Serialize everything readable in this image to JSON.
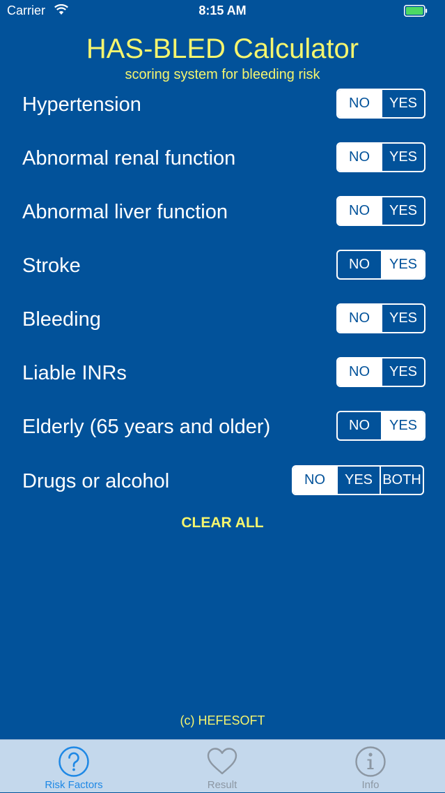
{
  "status_bar": {
    "carrier": "Carrier",
    "time": "8:15 AM"
  },
  "header": {
    "title": "HAS-BLED Calculator",
    "subtitle": "scoring system for bleeding risk"
  },
  "risk_factors": [
    {
      "label": "Hypertension",
      "options": [
        "NO",
        "YES"
      ],
      "selected": "NO"
    },
    {
      "label": "Abnormal renal function",
      "options": [
        "NO",
        "YES"
      ],
      "selected": "NO"
    },
    {
      "label": "Abnormal liver function",
      "options": [
        "NO",
        "YES"
      ],
      "selected": "NO"
    },
    {
      "label": "Stroke",
      "options": [
        "NO",
        "YES"
      ],
      "selected": "YES"
    },
    {
      "label": "Bleeding",
      "options": [
        "NO",
        "YES"
      ],
      "selected": "NO"
    },
    {
      "label": "Liable INRs",
      "options": [
        "NO",
        "YES"
      ],
      "selected": "NO"
    },
    {
      "label": "Elderly (65 years and older)",
      "options": [
        "NO",
        "YES"
      ],
      "selected": "YES"
    },
    {
      "label": "Drugs or alcohol",
      "options": [
        "NO",
        "YES",
        "BOTH"
      ],
      "selected": "NO"
    }
  ],
  "actions": {
    "clear_all": "CLEAR ALL"
  },
  "footer": {
    "copyright": "(c) HEFESOFT"
  },
  "tab_bar": {
    "tabs": [
      {
        "label": "Risk Factors",
        "icon": "question-circle-icon",
        "active": true
      },
      {
        "label": "Result",
        "icon": "heart-icon",
        "active": false
      },
      {
        "label": "Info",
        "icon": "info-circle-icon",
        "active": false
      }
    ]
  },
  "colors": {
    "background": "#02529a",
    "accent_yellow": "#f5f56e",
    "battery_green": "#4cd964",
    "tab_active": "#1e88e5",
    "tab_inactive": "#8c97a3",
    "tab_bar_bg": "#c4d8ec"
  }
}
